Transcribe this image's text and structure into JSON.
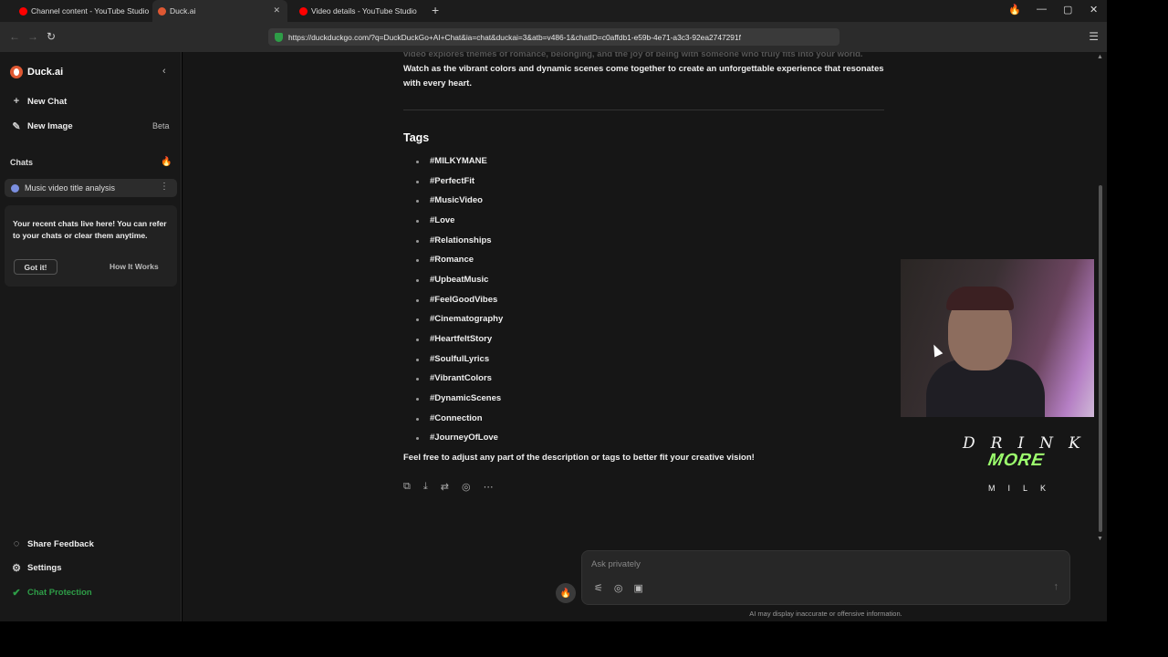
{
  "browser": {
    "tabs": [
      {
        "title": "Channel content - YouTube Studio",
        "color": "#ff0000"
      },
      {
        "title": "Duck.ai",
        "color": "#de5833"
      },
      {
        "title": "Video details - YouTube Studio",
        "color": "#ff0000"
      }
    ],
    "url": "https://duckduckgo.com/?q=DuckDuckGo+AI+Chat&ia=chat&duckai=3&atb=v486-1&chatID=c0affdb1-e59b-4e71-a3c3-92ea2747291f"
  },
  "sidebar": {
    "brand": "Duck.ai",
    "new_chat": "New Chat",
    "new_image": "New Image",
    "beta": "Beta",
    "chats_header": "Chats",
    "chat_item": "Music video title analysis",
    "tip_text": "Your recent chats live here! You can refer to your chats or clear them anytime.",
    "got_it": "Got it!",
    "how_it_works": "How It Works",
    "share_feedback": "Share Feedback",
    "settings": "Settings",
    "chat_protection": "Chat Protection"
  },
  "main": {
    "faded_line": "video explores themes of romance, belonging, and the joy of being with someone who truly fits into your world.",
    "paragraph": "Watch as the vibrant colors and dynamic scenes come together to create an unforgettable experience that resonates with every heart.",
    "tags_heading": "Tags",
    "tags": [
      "#MILKYMANE",
      "#PerfectFit",
      "#MusicVideo",
      "#Love",
      "#Relationships",
      "#Romance",
      "#UpbeatMusic",
      "#FeelGoodVibes",
      "#Cinematography",
      "#HeartfeltStory",
      "#SoulfulLyrics",
      "#VibrantColors",
      "#DynamicScenes",
      "#Connection",
      "#JourneyOfLove"
    ],
    "closing": "Feel free to adjust any part of the description or tags to better fit your creative vision!"
  },
  "composer": {
    "placeholder": "Ask privately",
    "disclaimer": "AI may display inaccurate or offensive information."
  },
  "overlay": {
    "logo_line1": "DRINK",
    "logo_line2": "MORE",
    "logo_line3": "MILK"
  }
}
